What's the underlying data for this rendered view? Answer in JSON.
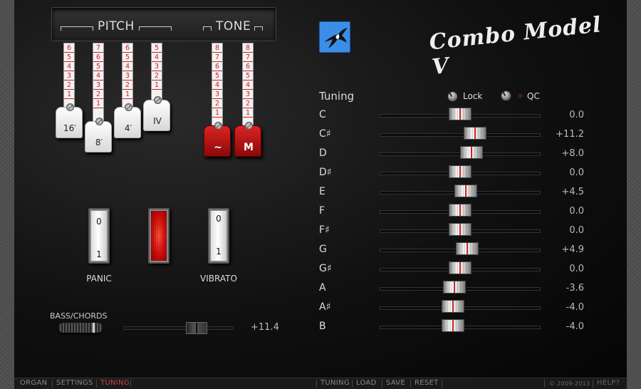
{
  "header": {
    "pitch_label": "PITCH",
    "tone_label": "TONE",
    "title": "Combo Model V"
  },
  "drawbars": [
    {
      "name": "drawbar-16",
      "label": "16′",
      "numbers": [
        "6",
        "5",
        "4",
        "3",
        "2",
        "1"
      ],
      "color": "white"
    },
    {
      "name": "drawbar-8",
      "label": "8′",
      "numbers": [
        "7",
        "6",
        "5",
        "4",
        "3",
        "2",
        "1"
      ],
      "color": "white"
    },
    {
      "name": "drawbar-4",
      "label": "4′",
      "numbers": [
        "6",
        "5",
        "4",
        "3",
        "2",
        "1"
      ],
      "color": "white"
    },
    {
      "name": "drawbar-iv",
      "label": "IV",
      "numbers": [
        "5",
        "4",
        "3",
        "2",
        "1"
      ],
      "color": "white"
    },
    {
      "name": "drawbar-tone-flute",
      "label": "~",
      "numbers": [
        "8",
        "7",
        "6",
        "5",
        "4",
        "3",
        "2",
        "1"
      ],
      "color": "red"
    },
    {
      "name": "drawbar-tone-m",
      "label": "M",
      "numbers": [
        "8",
        "7",
        "6",
        "5",
        "4",
        "3",
        "2",
        "1"
      ],
      "color": "red"
    }
  ],
  "switches": {
    "panic": {
      "label": "PANIC",
      "top": "0",
      "bottom": "1"
    },
    "vibrato": {
      "label": "VIBRATO",
      "top": "0",
      "bottom": "1"
    }
  },
  "bass": {
    "label": "BASS/CHORDS",
    "value": "+11.4",
    "position": 0.7
  },
  "tuning": {
    "title": "Tuning",
    "lock_label": "Lock",
    "qc_label": "QC",
    "notes": [
      {
        "note": "C",
        "value": "0.0",
        "pos": 0.5
      },
      {
        "note": "C♯",
        "value": "+11.2",
        "pos": 0.61
      },
      {
        "note": "D",
        "value": "+8.0",
        "pos": 0.58
      },
      {
        "note": "D♯",
        "value": "0.0",
        "pos": 0.5
      },
      {
        "note": "E",
        "value": "+4.5",
        "pos": 0.54
      },
      {
        "note": "F",
        "value": "0.0",
        "pos": 0.5
      },
      {
        "note": "F♯",
        "value": "0.0",
        "pos": 0.5
      },
      {
        "note": "G",
        "value": "+4.9",
        "pos": 0.55
      },
      {
        "note": "G♯",
        "value": "0.0",
        "pos": 0.5
      },
      {
        "note": "A",
        "value": "-3.6",
        "pos": 0.46
      },
      {
        "note": "A♯",
        "value": "-4.0",
        "pos": 0.45
      },
      {
        "note": "B",
        "value": "-4.0",
        "pos": 0.45
      }
    ]
  },
  "footer": {
    "left_tabs": [
      "ORGAN",
      "SETTINGS",
      "TUNING"
    ],
    "active_tab": "TUNING",
    "actions": [
      "TUNING",
      "LOAD",
      "SAVE",
      "RESET"
    ],
    "copyright": "© 2009-2013",
    "help": "HELP?"
  },
  "colors": {
    "accent_red": "#c22222",
    "logo_blue": "#3a8ee8",
    "panel_black": "#0a0a0a"
  }
}
